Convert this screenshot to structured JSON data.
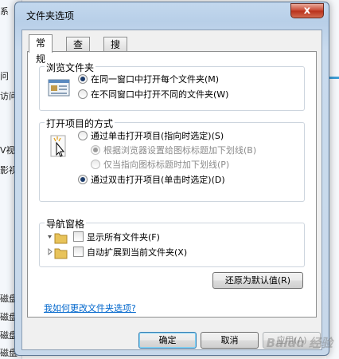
{
  "background": {
    "left_items": [
      "系",
      "问",
      "访问",
      "V视频",
      "影视",
      "磁盘",
      "磁盘",
      "磁盘",
      "磁盘"
    ]
  },
  "dialog": {
    "title": "文件夹选项",
    "close_glyph": "x",
    "tabs": [
      {
        "label": "常规"
      },
      {
        "label": "查看"
      },
      {
        "label": "搜索"
      }
    ],
    "browse_group": {
      "title": "浏览文件夹",
      "option_same": "在同一窗口中打开每个文件夹(M)",
      "option_new": "在不同窗口中打开不同的文件夹(W)"
    },
    "click_group": {
      "title": "打开项目的方式",
      "option_single": "通过单击打开项目(指向时选定)(S)",
      "sub_browser": "根据浏览器设置给图标标题加下划线(B)",
      "sub_point": "仅当指向图标标题时加下划线(P)",
      "option_double": "通过双击打开项目(单击时选定)(D)"
    },
    "nav_group": {
      "title": "导航窗格",
      "show_all": "显示所有文件夹(F)",
      "auto_expand": "自动扩展到当前文件夹(X)"
    },
    "restore_button": "还原为默认值(R)",
    "help_link": "我如何更改文件夹选项?",
    "buttons": {
      "ok": "确定",
      "cancel": "取消",
      "apply": "应用(A)"
    }
  },
  "watermark": "Baidu 经验"
}
